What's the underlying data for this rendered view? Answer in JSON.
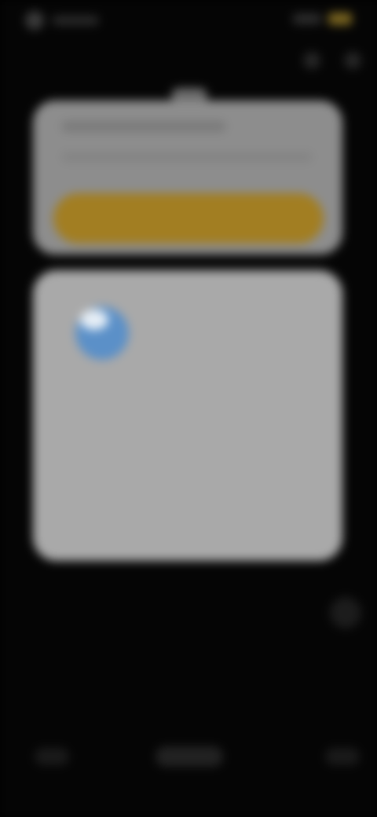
{
  "status_bar": {
    "time": "",
    "battery_color": "#7a6520"
  },
  "permission_card": {
    "message": "",
    "detail": "",
    "allow_label": ""
  },
  "dialog": {
    "icon": "app-icon",
    "title": "",
    "body": "",
    "secondary_label": "",
    "primary_label": ""
  },
  "colors": {
    "accent": "#a27e22",
    "dialog_bg": "#a9a9a9",
    "card_bg": "#8d8d8d",
    "icon_blue": "#5b90c8"
  },
  "navigation": {
    "back": "back-icon",
    "home": "home-icon",
    "recents": "recents-icon"
  }
}
